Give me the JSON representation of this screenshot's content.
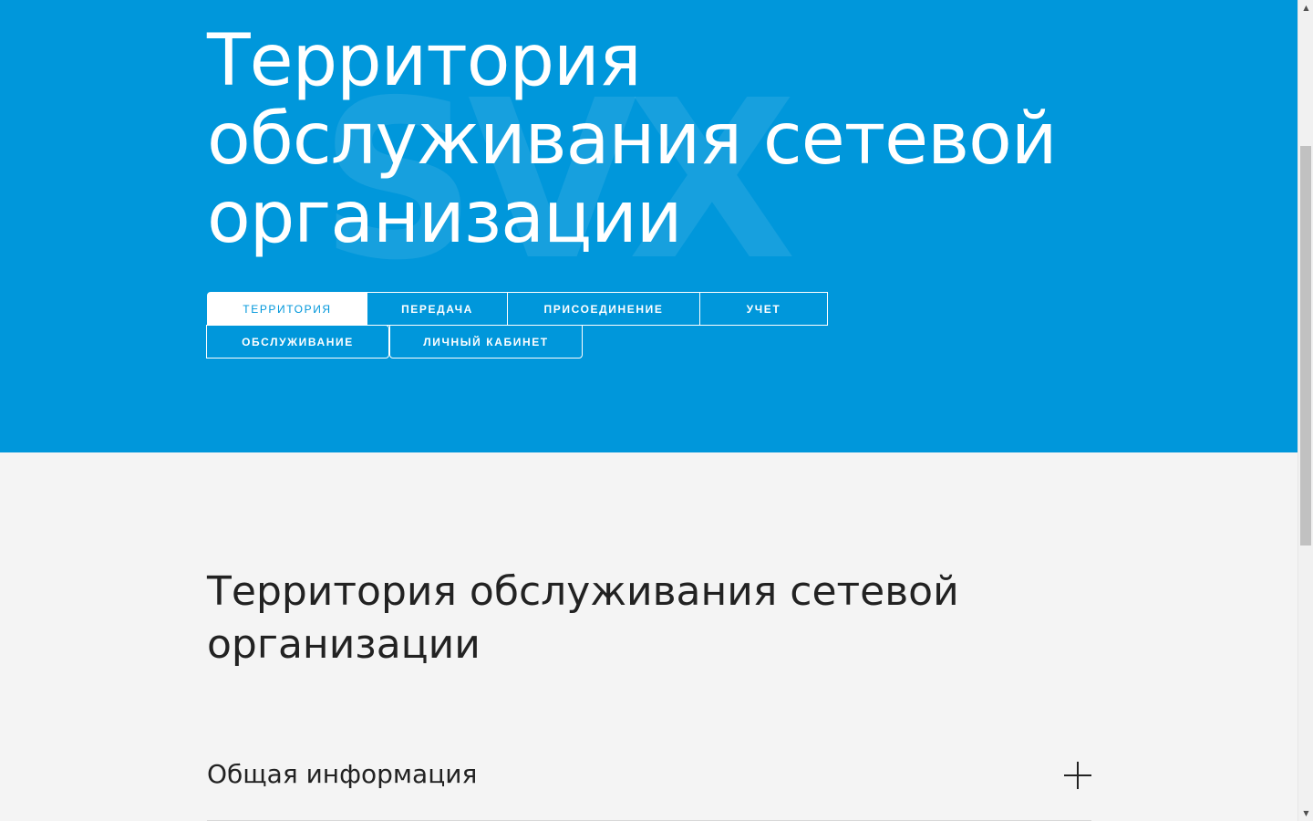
{
  "hero": {
    "title": "Территория обслуживания сетевой организации",
    "watermark": "SVX",
    "background_color": "#0097db"
  },
  "tabs": [
    {
      "label": "ТЕРРИТОРИЯ",
      "active": true
    },
    {
      "label": "ПЕРЕДАЧА",
      "active": false
    },
    {
      "label": "ПРИСОЕДИНЕНИЕ",
      "active": false
    },
    {
      "label": "УЧЕТ",
      "active": false
    },
    {
      "label": "ОБСЛУЖИВАНИЕ",
      "active": false
    },
    {
      "label": "ЛИЧНЫЙ КАБИНЕТ",
      "active": false
    }
  ],
  "main": {
    "section_title": "Территория обслуживания сетевой организации",
    "accordion": {
      "label": "Общая информация",
      "icon": "plus-icon",
      "expanded": false
    }
  },
  "scrollbar": {
    "up_icon": "▲",
    "down_icon": "▼"
  }
}
